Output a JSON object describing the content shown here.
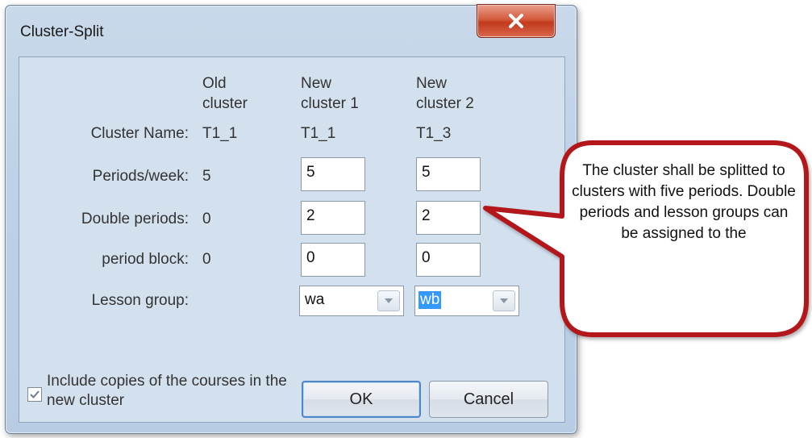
{
  "window": {
    "title": "Cluster-Split"
  },
  "columns": {
    "old": "Old\ncluster",
    "new1": "New\ncluster 1",
    "new2": "New\ncluster 2"
  },
  "rows": {
    "cluster_name": {
      "label": "Cluster Name:",
      "old": "T1_1",
      "new1": "T1_1",
      "new2": "T1_3"
    },
    "periods_week": {
      "label": "Periods/week:",
      "old": "5",
      "new1": "5",
      "new2": "5"
    },
    "double_periods": {
      "label": "Double periods:",
      "old": "0",
      "new1": "2",
      "new2": "2"
    },
    "period_block": {
      "label": "period block:",
      "old": "0",
      "new1": "0",
      "new2": "0"
    },
    "lesson_group": {
      "label": "Lesson group:",
      "new1": "wa",
      "new2": "wb"
    }
  },
  "include_copies": {
    "label": "Include copies of the courses in the new cluster",
    "checked": true
  },
  "buttons": {
    "ok": "OK",
    "cancel": "Cancel"
  },
  "callout": {
    "text": "The cluster shall be splitted to clusters with five periods. Double periods and lesson groups can be assigned to the"
  },
  "colors": {
    "callout_border": "#b3171b",
    "selection": "#3399ff",
    "close_button": "#c94a2e"
  }
}
